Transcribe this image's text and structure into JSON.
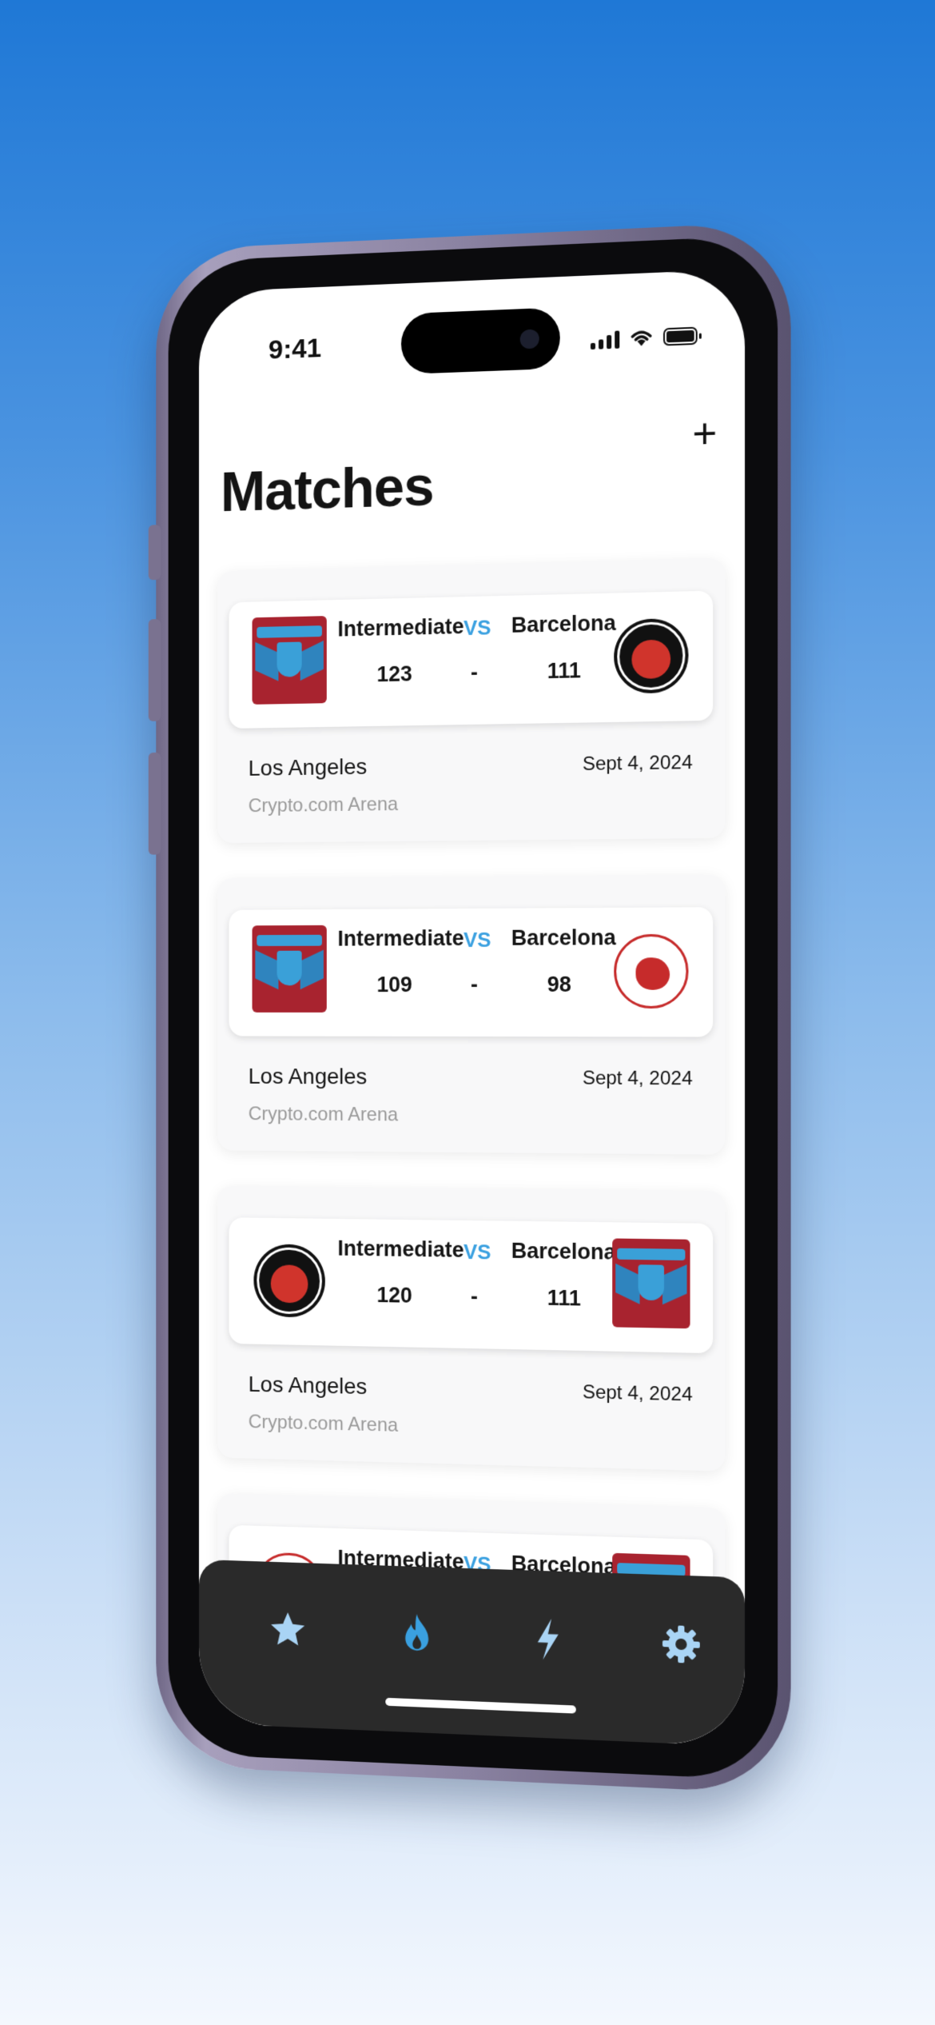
{
  "status": {
    "time": "9:41"
  },
  "header": {
    "title": "Matches",
    "add_label": "+"
  },
  "matches": [
    {
      "home_team": "Intermediate",
      "away_team": "Barcelona",
      "vs": "VS",
      "home_score": "123",
      "separator": "-",
      "away_score": "111",
      "home_logo": "intermediate-logo",
      "away_logo": "wildcats-logo",
      "city": "Los Angeles",
      "venue": "Crypto.com Arena",
      "date": "Sept 4, 2024"
    },
    {
      "home_team": "Intermediate",
      "away_team": "Barcelona",
      "vs": "VS",
      "home_score": "109",
      "separator": "-",
      "away_score": "98",
      "home_logo": "intermediate-logo",
      "away_logo": "stingers-logo",
      "city": "Los Angeles",
      "venue": "Crypto.com Arena",
      "date": "Sept 4, 2024"
    },
    {
      "home_team": "Intermediate",
      "away_team": "Barcelona",
      "vs": "VS",
      "home_score": "120",
      "separator": "-",
      "away_score": "111",
      "home_logo": "wildcats-logo",
      "away_logo": "intermediate-logo",
      "city": "Los Angeles",
      "venue": "Crypto.com Arena",
      "date": "Sept 4, 2024"
    },
    {
      "home_team": "Intermediate",
      "away_team": "Barcelona",
      "vs": "VS",
      "home_logo": "stingers-logo",
      "away_logo": "intermediate-logo"
    }
  ],
  "tabbar": {
    "items": [
      {
        "icon": "star-icon",
        "color": "#a9d4f5"
      },
      {
        "icon": "flame-icon",
        "color": "#3aa0e0",
        "active": true
      },
      {
        "icon": "bolt-icon",
        "color": "#a9d4f5"
      },
      {
        "icon": "gear-icon",
        "color": "#a9d4f5"
      }
    ]
  },
  "colors": {
    "accent": "#3aa0e0",
    "tabbar_bg": "#2a2a2a",
    "card_bg": "#f8f8f9"
  }
}
